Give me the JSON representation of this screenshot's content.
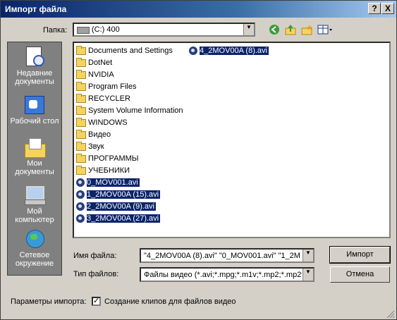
{
  "window": {
    "title": "Импорт файла",
    "help_button": "?",
    "close_button": "X"
  },
  "toolbar": {
    "look_in_label": "Папка:",
    "look_in_value": "(C:) 400"
  },
  "places": [
    {
      "label": "Недавние документы"
    },
    {
      "label": "Рабочий стол"
    },
    {
      "label": "Мои документы"
    },
    {
      "label": "Мой компьютер"
    },
    {
      "label": "Сетевое окружение"
    }
  ],
  "files": {
    "folders": [
      "Documents and Settings",
      "DotNet",
      "NVIDIA",
      "Program Files",
      "RECYCLER",
      "System Volume Information",
      "WINDOWS",
      "Видео",
      "Звук",
      "ПРОГРАММЫ",
      "УЧЕБНИКИ"
    ],
    "videos": [
      "0_MOV001.avi",
      "1_2MOV00A (15).avi",
      "2_2MOV00A (9).avi",
      "3_2MOV00A (27).avi"
    ],
    "second_column": [
      "4_2MOV00A (8).avi"
    ]
  },
  "filename": {
    "label": "Имя файла:",
    "value": "\"4_2MOV00A (8).avi\" \"0_MOV001.avi\" \"1_2M"
  },
  "filetype": {
    "label": "Тип файлов:",
    "value": "Файлы видео (*.avi;*.mpg;*.m1v;*.mp2;*.mp2v"
  },
  "buttons": {
    "open": "Импорт",
    "cancel": "Отмена"
  },
  "options": {
    "label": "Параметры импорта:",
    "checkbox_label": "Создание клипов для файлов видео",
    "checked": true
  }
}
